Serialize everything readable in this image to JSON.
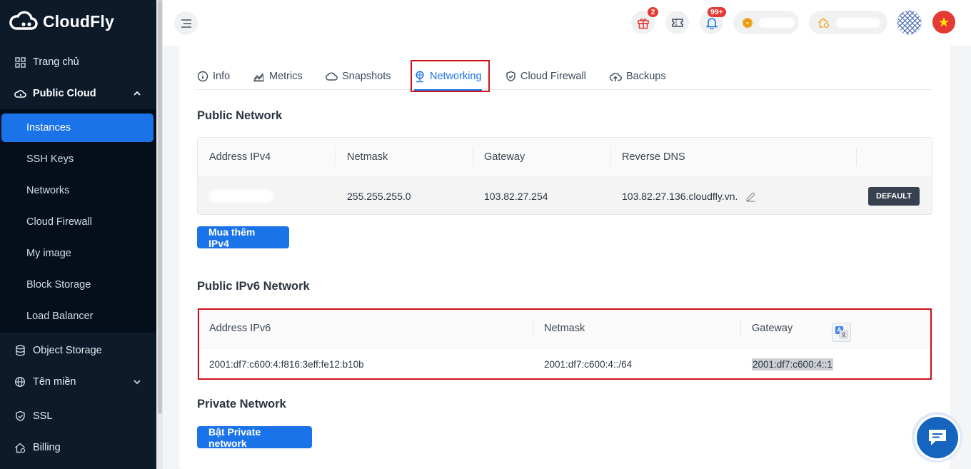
{
  "app": {
    "name": "CloudFly"
  },
  "sidebar": {
    "items": [
      {
        "label": "Trang chủ",
        "icon": "grid-icon"
      },
      {
        "label": "Public Cloud",
        "icon": "cloud-icon"
      },
      {
        "label": "Object Storage",
        "icon": "database-icon"
      },
      {
        "label": "Tên miền",
        "icon": "globe-icon"
      },
      {
        "label": "SSL",
        "icon": "shield-icon"
      },
      {
        "label": "Billing",
        "icon": "billing-icon"
      }
    ],
    "submenu": [
      {
        "label": "Instances",
        "active": true
      },
      {
        "label": "SSH Keys"
      },
      {
        "label": "Networks"
      },
      {
        "label": "Cloud Firewall"
      },
      {
        "label": "My image"
      },
      {
        "label": "Block Storage"
      },
      {
        "label": "Load Balancer"
      }
    ]
  },
  "header": {
    "gift_badge": "2",
    "notification_badge": "99+"
  },
  "tabs": [
    {
      "label": "Info",
      "icon": "info-icon"
    },
    {
      "label": "Metrics",
      "icon": "chart-icon"
    },
    {
      "label": "Snapshots",
      "icon": "cloud-icon"
    },
    {
      "label": "Networking",
      "icon": "network-icon",
      "active": true
    },
    {
      "label": "Cloud Firewall",
      "icon": "shield-icon"
    },
    {
      "label": "Backups",
      "icon": "cloud-upload-icon"
    }
  ],
  "public_network": {
    "title": "Public Network",
    "columns": [
      "Address IPv4",
      "Netmask",
      "Gateway",
      "Reverse DNS"
    ],
    "row": {
      "netmask": "255.255.255.0",
      "gateway": "103.82.27.254",
      "reverse_dns": "103.82.27.136.cloudfly.vn.",
      "tag": "DEFAULT"
    },
    "button": "Mua thêm IPv4"
  },
  "ipv6_network": {
    "title": "Public IPv6 Network",
    "columns": [
      "Address IPv6",
      "Netmask",
      "Gateway"
    ],
    "row": {
      "address": "2001:df7:c600:4:f816:3eff:fe12:b10b",
      "netmask": "2001:df7:c600:4::/64",
      "gateway": "2001:df7:c600:4::1"
    }
  },
  "private_network": {
    "title": "Private Network",
    "button": "Bật Private network"
  },
  "colors": {
    "sidebar_bg": "#0c1a2a",
    "accent": "#1a73e8",
    "highlight_border": "#d0121b"
  }
}
